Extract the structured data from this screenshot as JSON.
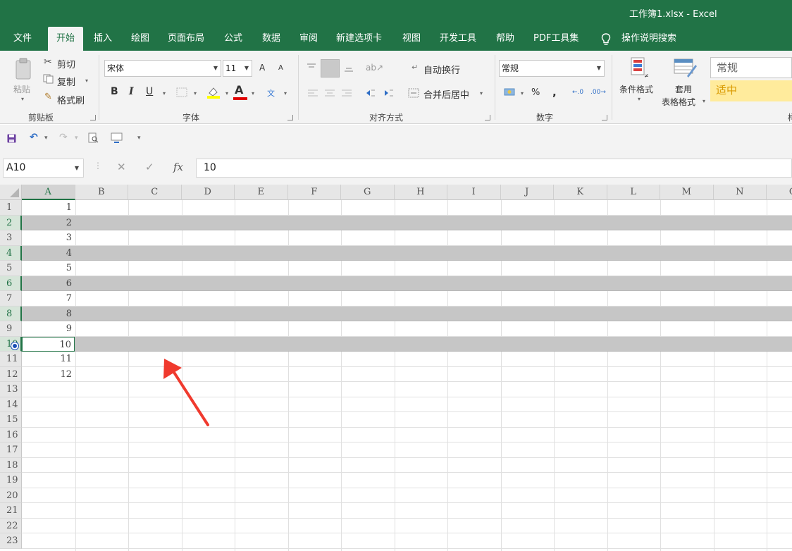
{
  "window": {
    "title": "工作簿1.xlsx  -  Excel"
  },
  "tabs": [
    "文件",
    "开始",
    "插入",
    "绘图",
    "页面布局",
    "公式",
    "数据",
    "审阅",
    "新建选项卡",
    "视图",
    "开发工具",
    "帮助",
    "PDF工具集"
  ],
  "active_tab": "开始",
  "search": {
    "label": "操作说明搜索",
    "icon": "lightbulb-icon"
  },
  "ribbon": {
    "clipboard": {
      "label": "剪贴板",
      "paste": "粘贴",
      "cut": "剪切",
      "copy": "复制",
      "format_painter": "格式刷"
    },
    "font": {
      "label": "字体",
      "font_name": "宋体",
      "font_size": "11",
      "bold": "B",
      "italic": "I",
      "underline": "U",
      "grow_font": "A",
      "shrink_font": "A",
      "font_color_letter": "A",
      "phonetic": "文"
    },
    "alignment": {
      "label": "对齐方式",
      "wrap_text": "自动换行",
      "merge_center": "合并后居中"
    },
    "number": {
      "label": "数字",
      "format": "常规",
      "percent": "%",
      "comma": ","
    },
    "styles": {
      "conditional_format": "条件格式",
      "table_format_line1": "套用",
      "table_format_line2": "表格格式",
      "style_normal": "常规",
      "style_neutral": "适中",
      "label_partial": "样"
    }
  },
  "formula_bar": {
    "name_box": "A10",
    "fx": "fx",
    "value": "10"
  },
  "grid": {
    "columns": [
      "A",
      "B",
      "C",
      "D",
      "E",
      "F",
      "G",
      "H",
      "I",
      "J",
      "K",
      "L",
      "M",
      "N",
      "O"
    ],
    "selected_column": "A",
    "active_cell": "A10",
    "row_numbers": [
      "1",
      "2",
      "3",
      "4",
      "5",
      "6",
      "7",
      "8",
      "9",
      "10",
      "11",
      "12",
      "13",
      "14",
      "15",
      "16",
      "17",
      "18",
      "19",
      "20",
      "21",
      "22",
      "23"
    ],
    "column_a_values": [
      "1",
      "2",
      "3",
      "4",
      "5",
      "6",
      "7",
      "8",
      "9",
      "10",
      "11",
      "12"
    ],
    "shaded_rows": [
      2,
      4,
      6,
      8,
      10
    ],
    "fill_color": "#c6c6c6",
    "accent_color": "#217346"
  }
}
